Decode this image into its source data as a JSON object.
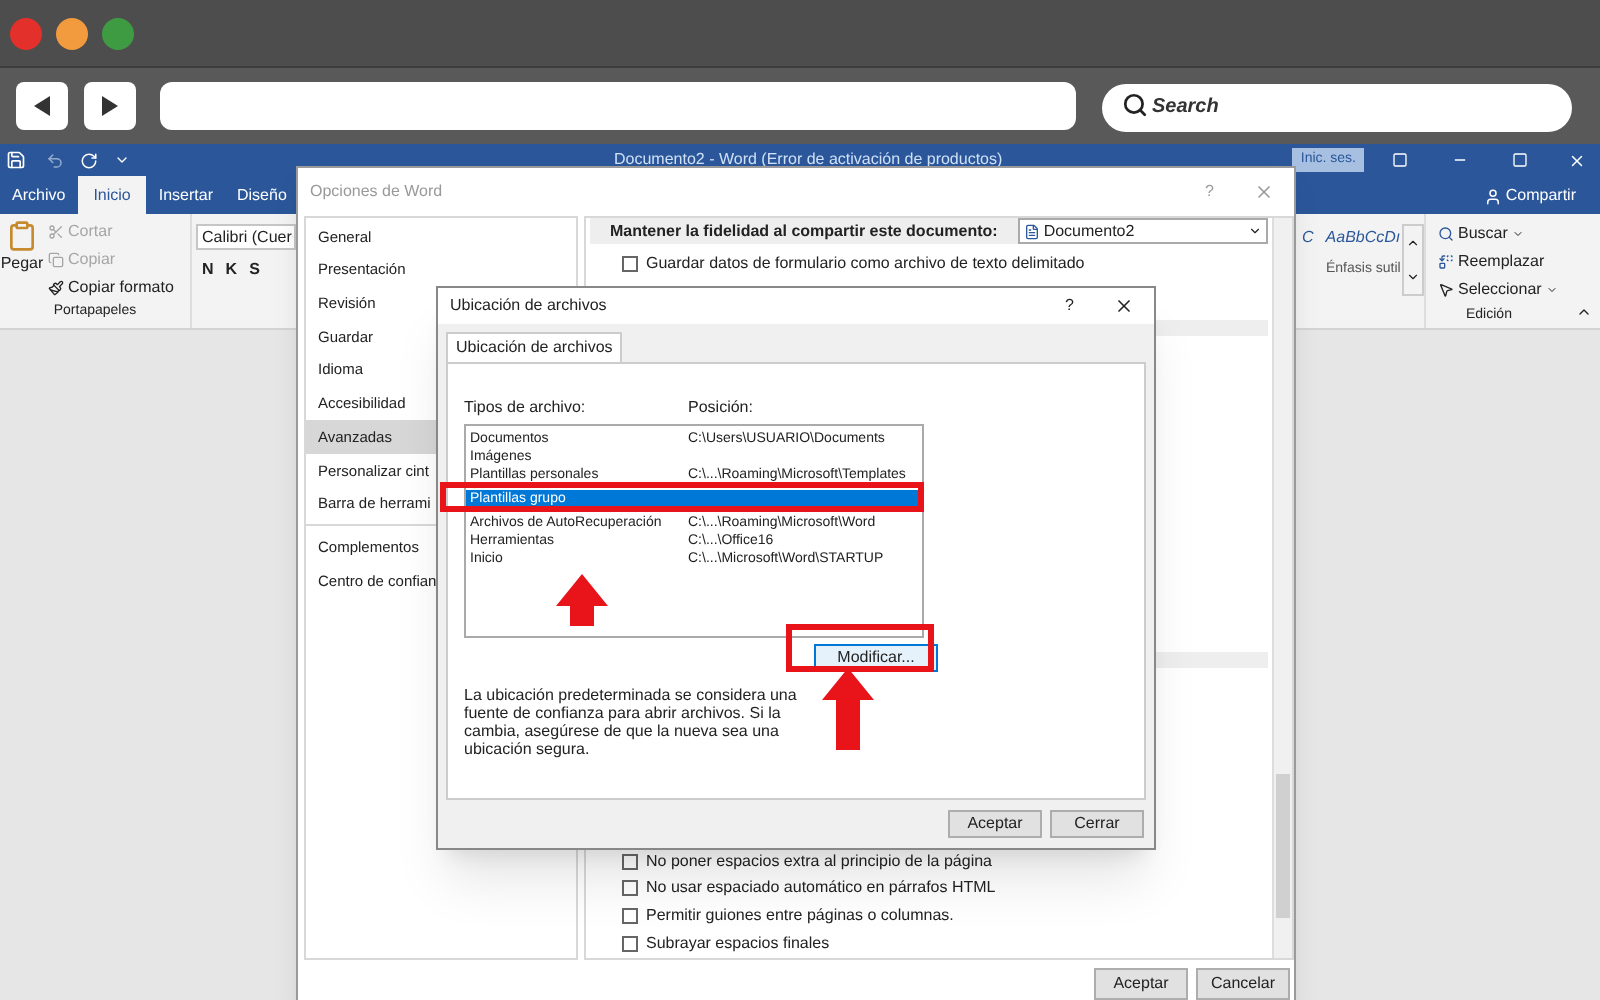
{
  "browser": {
    "search": {
      "placeholder": "Search"
    }
  },
  "word": {
    "title": "Documento2 - Word (Error de activación de productos)",
    "sign_in": "Inic. ses.",
    "share": "Compartir",
    "tabs": [
      {
        "label": "Archivo",
        "selected": false
      },
      {
        "label": "Inicio",
        "selected": true
      },
      {
        "label": "Insertar",
        "selected": false
      },
      {
        "label": "Diseño",
        "selected": false
      }
    ],
    "clipboard": {
      "paste": "Pegar",
      "group": "Portapapeles",
      "items": [
        {
          "label": "Cortar",
          "disabled": true
        },
        {
          "label": "Copiar",
          "disabled": true
        },
        {
          "label": "Copiar formato",
          "disabled": false
        }
      ]
    },
    "font": {
      "value": "Calibri (Cuer",
      "buttons": [
        "N",
        "K",
        "S"
      ]
    },
    "styles": {
      "fragment": "C",
      "sample": "AaBbCcDı",
      "name": "Énfasis sutil"
    },
    "editing": {
      "group": "Edición",
      "items": [
        {
          "label": "Buscar",
          "kind": "dropdown"
        },
        {
          "label": "Reemplazar",
          "kind": "button"
        },
        {
          "label": "Seleccionar",
          "kind": "dropdown"
        }
      ]
    }
  },
  "options_dialog": {
    "title": "Opciones de Word",
    "help": "?",
    "nav": [
      {
        "label": "General",
        "selected": false
      },
      {
        "label": "Presentación",
        "selected": false
      },
      {
        "label": "Revisión",
        "selected": false
      },
      {
        "label": "Guardar",
        "selected": false
      },
      {
        "label": "Idioma",
        "selected": false
      },
      {
        "label": "Accesibilidad",
        "selected": false
      },
      {
        "label": "Avanzadas",
        "selected": true
      },
      {
        "label": "Personalizar cint",
        "selected": false
      },
      {
        "label": "Barra de herrami",
        "selected": false
      }
    ],
    "nav_extra": [
      {
        "label": "Complementos",
        "selected": false
      },
      {
        "label": "Centro de confian",
        "selected": false
      }
    ],
    "fidelity": {
      "label": "Mantener la fidelidad al compartir este documento:",
      "document": "Documento2"
    },
    "top_checks": [
      {
        "label": "Guardar datos de formulario como archivo de texto delimitado",
        "checked": false
      }
    ],
    "bottom_checks": [
      {
        "label": "No poner espacios extra al principio de la página",
        "checked": false
      },
      {
        "label": "No usar espaciado automático en párrafos HTML",
        "checked": false
      },
      {
        "label": "Permitir guiones entre páginas o columnas.",
        "checked": false
      },
      {
        "label": "Subrayar espacios finales",
        "checked": false
      }
    ],
    "buttons": [
      "Aceptar",
      "Cancelar"
    ]
  },
  "files_dialog": {
    "title": "Ubicación de archivos",
    "help": "?",
    "tab": "Ubicación de archivos",
    "columns": [
      "Tipos de archivo:",
      "Posición:"
    ],
    "rows": [
      {
        "type": "Documentos",
        "path": "C:\\Users\\USUARIO\\Documents",
        "selected": false
      },
      {
        "type": "Imágenes",
        "selected": false
      },
      {
        "type": "Plantillas personales",
        "path": "C:\\...\\Roaming\\Microsoft\\Templates",
        "selected": false
      },
      {
        "type": "Plantillas grupo",
        "selected": true
      },
      {
        "type": "Archivos de AutoRecuperación",
        "path": "C:\\...\\Roaming\\Microsoft\\Word",
        "selected": false
      },
      {
        "type": "Herramientas",
        "path": "C:\\...\\Office16",
        "selected": false
      },
      {
        "type": "Inicio",
        "path": "C:\\...\\Microsoft\\Word\\STARTUP",
        "selected": false
      }
    ],
    "modify": "Modificar...",
    "note": "La ubicación predeterminada se considera una fuente de confianza para abrir archivos. Si la cambia, asegúrese de que la nueva sea una ubicación segura.",
    "buttons": [
      "Aceptar",
      "Cerrar"
    ]
  }
}
